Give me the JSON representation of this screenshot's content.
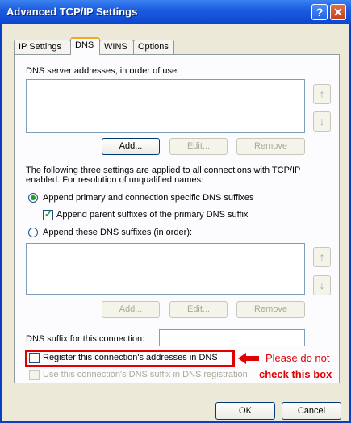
{
  "window": {
    "title": "Advanced TCP/IP Settings",
    "help_label": "?",
    "close_label": "✕"
  },
  "tabs": [
    {
      "label": "IP Settings"
    },
    {
      "label": "DNS"
    },
    {
      "label": "WINS"
    },
    {
      "label": "Options"
    }
  ],
  "dns": {
    "servers_label": "DNS server addresses, in order of use:",
    "add_label": "Add...",
    "edit_label": "Edit...",
    "remove_label": "Remove",
    "up_label": "↑",
    "down_label": "↓",
    "info_text": "The following three settings are applied to all connections with TCP/IP enabled. For resolution of unqualified names:",
    "radio_primary_label": "Append primary and connection specific DNS suffixes",
    "check_parent_label": "Append parent suffixes of the primary DNS suffix",
    "radio_these_label": "Append these DNS suffixes (in order):",
    "add2_label": "Add...",
    "edit2_label": "Edit...",
    "remove2_label": "Remove",
    "suffix_label": "DNS suffix for this connection:",
    "register_label": "Register this connection's addresses in DNS",
    "use_suffix_label": "Use this connection's DNS suffix in DNS registration",
    "radio_primary_checked": true,
    "check_parent_checked": true,
    "register_checked": false,
    "use_suffix_checked": false
  },
  "annotation": {
    "line1": "Please do not",
    "line2": "check this box",
    "color": "#e00000"
  },
  "footer": {
    "ok_label": "OK",
    "cancel_label": "Cancel"
  }
}
